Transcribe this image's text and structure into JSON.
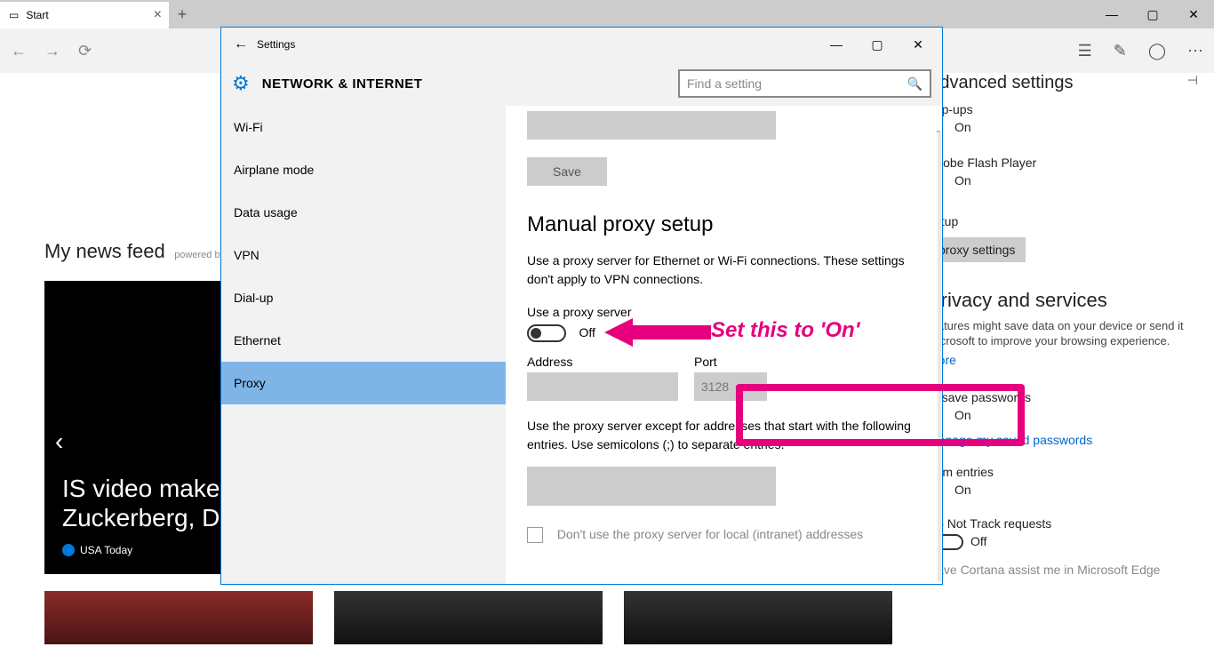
{
  "edge": {
    "tab_title": "Start",
    "newsfeed_title": "My news feed",
    "newsfeed_sub": "powered by M",
    "card_headline": "IS video makes Zuckerberg, Do",
    "card_source": "USA Today"
  },
  "win_controls": {
    "min": "—",
    "max": "▢",
    "close": "✕"
  },
  "adv": {
    "title": "Advanced settings",
    "popups": "pop-ups",
    "on": "On",
    "flash": "Adobe Flash Player",
    "setup": "setup",
    "proxy_btn": "proxy settings",
    "privacy": "Privacy and services",
    "privacy_desc": "features might save data on your device or send it Microsoft to improve your browsing experience.",
    "more": "more",
    "save_pw": "to save passwords",
    "manage_pw": "Manage my saved passwords",
    "form": "form entries",
    "dnt": "Do Not Track requests",
    "off": "Off",
    "cortana": "Have Cortana assist me in Microsoft Edge"
  },
  "settings": {
    "title": "Settings",
    "header": "NETWORK & INTERNET",
    "search_placeholder": "Find a setting",
    "nav": [
      "Wi-Fi",
      "Airplane mode",
      "Data usage",
      "VPN",
      "Dial-up",
      "Ethernet",
      "Proxy"
    ],
    "selected_index": 6
  },
  "proxy": {
    "save": "Save",
    "manual_title": "Manual proxy setup",
    "manual_desc": "Use a proxy server for Ethernet or Wi-Fi connections. These settings don't apply to VPN connections.",
    "use_proxy": "Use a proxy server",
    "toggle_state": "Off",
    "address_label": "Address",
    "port_label": "Port",
    "port_value": "3128",
    "exceptions": "Use the proxy server except for addresses that start with the following entries. Use semicolons (;) to separate entries.",
    "local": "Don't use the proxy server for local (intranet) addresses"
  },
  "annotation": {
    "text": "Set this to 'On'"
  }
}
